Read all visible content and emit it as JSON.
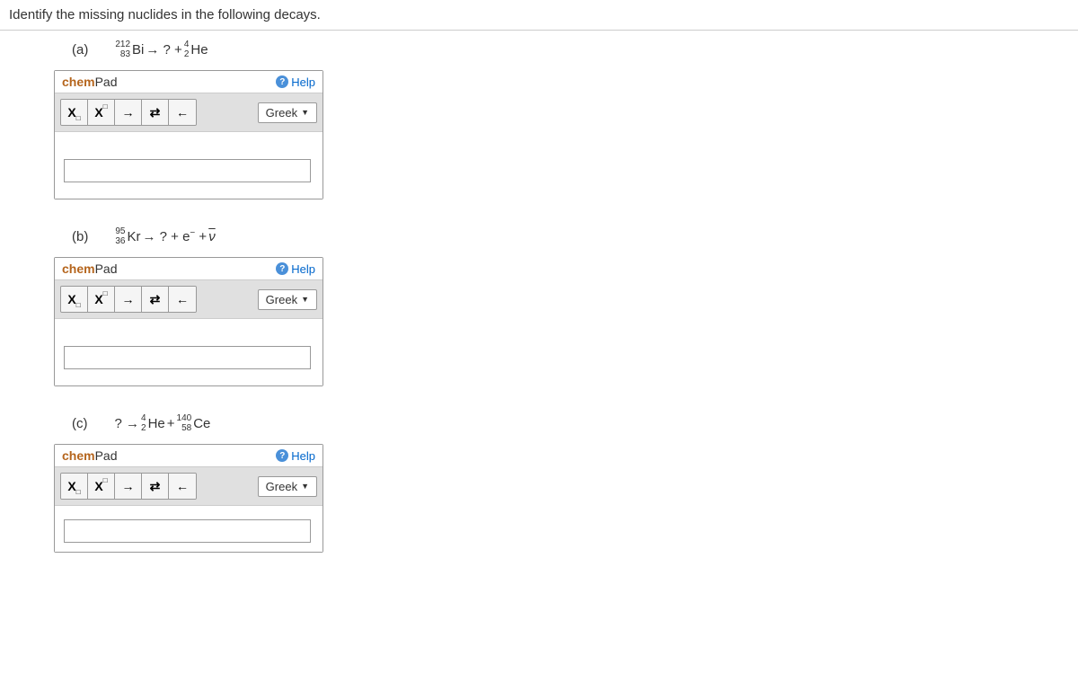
{
  "question": "Identify the missing nuclides in the following decays.",
  "chempad": {
    "title_chem": "chem",
    "title_pad": "Pad",
    "help_label": "Help",
    "help_icon": "?",
    "greek_label": "Greek",
    "tools": {
      "subscript": "X",
      "subscript_box": "□",
      "superscript": "X",
      "superscript_box": "□",
      "arrow_right": "→",
      "equilibrium": "⇄",
      "arrow_left": "←"
    }
  },
  "parts": [
    {
      "label": "(a)",
      "equation": {
        "reactant": {
          "mass": "212",
          "atomic": "83",
          "element": "Bi"
        },
        "products_text": " → ? + ",
        "product": {
          "mass": "4",
          "atomic": "2",
          "element": "He"
        }
      }
    },
    {
      "label": "(b)",
      "equation": {
        "reactant": {
          "mass": "95",
          "atomic": "36",
          "element": "Kr"
        },
        "products_text": " → ? + e⁻ + ",
        "neutrino": "ν"
      }
    },
    {
      "label": "(c)",
      "equation": {
        "reactant_text": "? → ",
        "product1": {
          "mass": "4",
          "atomic": "2",
          "element": "He"
        },
        "plus": " + ",
        "product2": {
          "mass": "140",
          "atomic": "58",
          "element": "Ce"
        }
      }
    }
  ]
}
